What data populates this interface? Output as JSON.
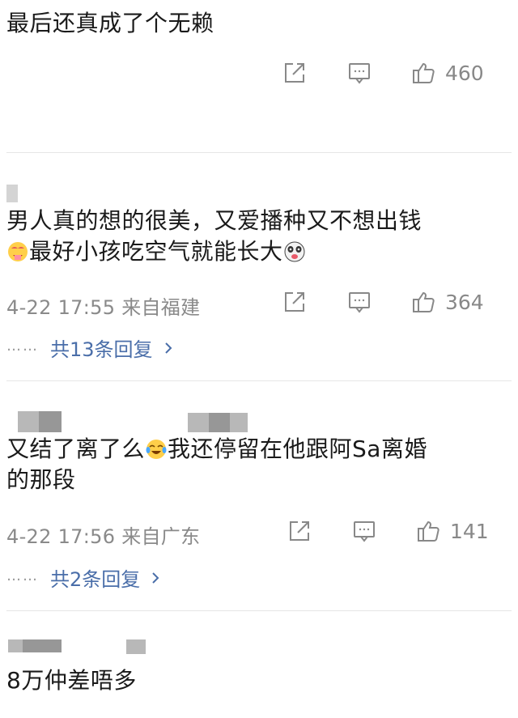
{
  "comments": [
    {
      "text": "最后还真成了个无赖",
      "likes": "460"
    },
    {
      "text_line1": "男人真的想的很美，又爱播种又不想出钱",
      "text_line2": "最好小孩吃空气就能长大",
      "meta": "4-22 17:55 来自福建",
      "likes": "364",
      "replies_dots": "……",
      "replies_label": "共13条回复"
    },
    {
      "text_line1_a": "又结了离了么",
      "text_line1_b": "我还停留在他跟阿Sa离婚",
      "text_line2": "的那段",
      "meta": "4-22 17:56 来自广东",
      "likes": "141",
      "replies_dots": "……",
      "replies_label": "共2条回复"
    },
    {
      "text": "8万仲差唔多"
    }
  ],
  "icons": {
    "share": "share-icon",
    "comment": "comment-icon",
    "like": "thumbs-up-icon",
    "chevron": "chevron-right-icon"
  },
  "colors": {
    "text": "#1a1a1a",
    "meta": "#8a8a8a",
    "link": "#4a6ea9",
    "divider": "#e6e6e6",
    "icon": "#888888"
  }
}
